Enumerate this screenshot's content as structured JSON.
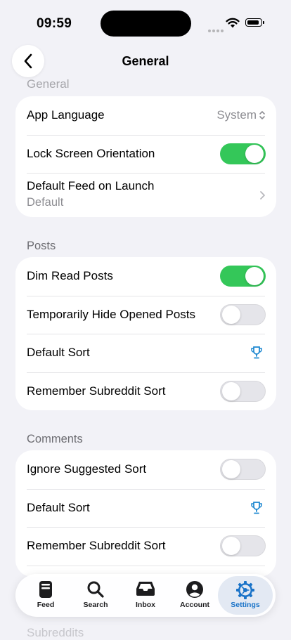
{
  "status": {
    "time": "09:59"
  },
  "nav": {
    "title": "General"
  },
  "sections": {
    "general": {
      "header": "General",
      "app_language": {
        "label": "App Language",
        "value": "System"
      },
      "lock_orientation": {
        "label": "Lock Screen Orientation",
        "on": true
      },
      "default_feed": {
        "label": "Default Feed on Launch",
        "value": "Default"
      }
    },
    "posts": {
      "header": "Posts",
      "dim_read": {
        "label": "Dim Read Posts",
        "on": true
      },
      "hide_opened": {
        "label": "Temporarily Hide Opened Posts",
        "on": false
      },
      "default_sort": {
        "label": "Default Sort"
      },
      "remember_sort": {
        "label": "Remember Subreddit Sort",
        "on": false
      }
    },
    "comments": {
      "header": "Comments",
      "ignore_suggested": {
        "label": "Ignore Suggested Sort",
        "on": false
      },
      "default_sort": {
        "label": "Default Sort"
      },
      "remember_sort": {
        "label": "Remember Subreddit Sort",
        "on": false
      }
    },
    "subreddits": {
      "header": "Subreddits"
    }
  },
  "tabs": [
    {
      "label": "Feed",
      "icon": "feed-icon"
    },
    {
      "label": "Search",
      "icon": "search-icon"
    },
    {
      "label": "Inbox",
      "icon": "inbox-icon"
    },
    {
      "label": "Account",
      "icon": "account-icon"
    },
    {
      "label": "Settings",
      "icon": "settings-icon",
      "active": true
    }
  ],
  "colors": {
    "accent": "#1a73c8",
    "toggle_on": "#34c759",
    "trophy": "#1a86d0"
  }
}
